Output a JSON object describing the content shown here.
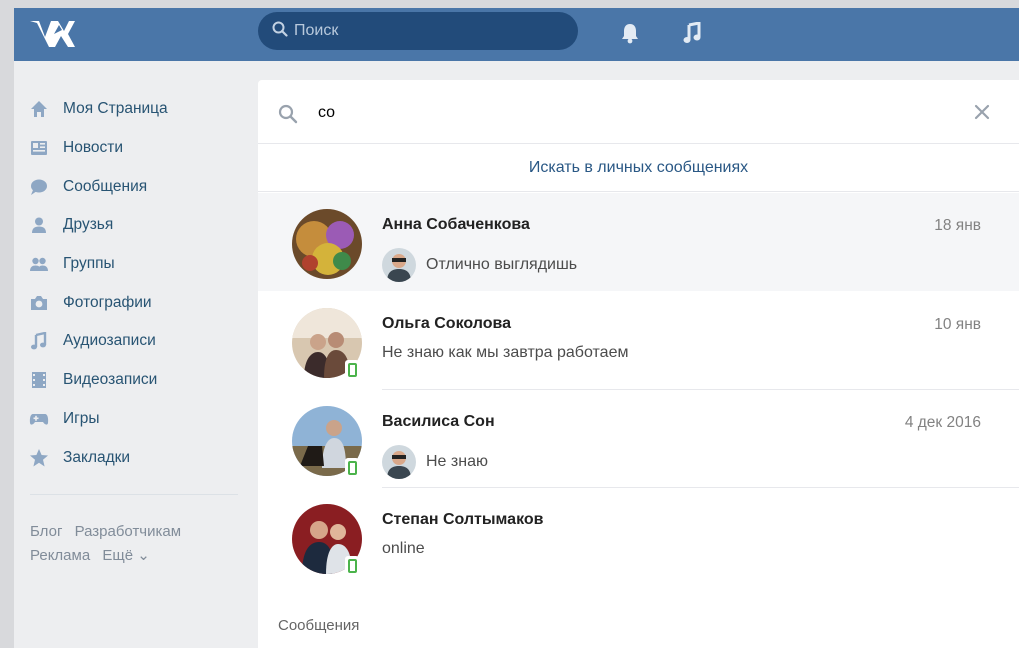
{
  "header": {
    "search_placeholder": "Поиск",
    "icons": [
      "vk-logo-icon",
      "search-icon",
      "bell-icon",
      "music-note-icon"
    ]
  },
  "sidebar": {
    "items": [
      {
        "label": "Моя Страница",
        "icon": "home-icon"
      },
      {
        "label": "Новости",
        "icon": "news-icon"
      },
      {
        "label": "Сообщения",
        "icon": "message-bubble-icon"
      },
      {
        "label": "Друзья",
        "icon": "person-icon"
      },
      {
        "label": "Группы",
        "icon": "group-icon"
      },
      {
        "label": "Фотографии",
        "icon": "camera-icon"
      },
      {
        "label": "Аудиозаписи",
        "icon": "music-note-icon"
      },
      {
        "label": "Видеозаписи",
        "icon": "film-icon"
      },
      {
        "label": "Игры",
        "icon": "gamepad-icon"
      },
      {
        "label": "Закладки",
        "icon": "star-icon"
      }
    ],
    "footer": {
      "blog": "Блог",
      "developers": "Разработчикам",
      "ads": "Реклама",
      "more": "Ещё ⌄"
    }
  },
  "messages": {
    "search_query": "со",
    "search_in_private": "Искать в личных сообщениях",
    "dialogs": [
      {
        "name": "Анна Собаченкова",
        "date": "18 янв",
        "message": "Отлично выглядишь",
        "has_sender_avatar": true,
        "mobile": false,
        "active": true
      },
      {
        "name": "Ольга Соколова",
        "date": "10 янв",
        "message": "Не знаю как мы завтра работаем",
        "has_sender_avatar": false,
        "mobile": true,
        "active": false
      },
      {
        "name": "Василиса Сон",
        "date": "4 дек 2016",
        "message": "Не знаю",
        "has_sender_avatar": true,
        "mobile": true,
        "active": false
      },
      {
        "name": "Степан Солтымаков",
        "date": "",
        "message": "online",
        "has_sender_avatar": false,
        "mobile": true,
        "active": false
      }
    ],
    "section_title": "Сообщения"
  },
  "colors": {
    "header_bg": "#4a76a8",
    "search_bg": "#224b7a",
    "link": "#2a5885",
    "sidebar_text": "#285473",
    "online_green": "#4bb34b"
  }
}
